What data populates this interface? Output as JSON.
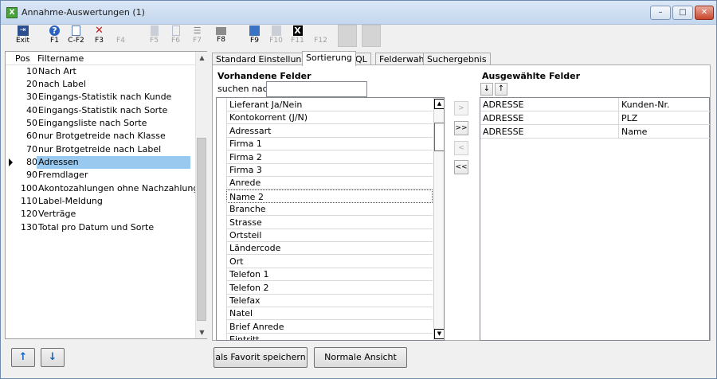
{
  "window": {
    "title": "Annahme-Auswertungen (1)",
    "app_icon": "X",
    "controls": {
      "minimize": "–",
      "maximize": "□",
      "close": "✕"
    }
  },
  "toolbar": {
    "items": [
      {
        "label": "Exit",
        "icon": "door-exit-icon",
        "glyph": "🚪",
        "enabled": true
      },
      {
        "label": "F1",
        "icon": "help-icon",
        "glyph": "?",
        "enabled": true
      },
      {
        "label": "C-F2",
        "icon": "new-document-icon",
        "glyph": "📄",
        "enabled": true
      },
      {
        "label": "F3",
        "icon": "delete-icon",
        "glyph": "✕",
        "enabled": true
      },
      {
        "label": "F4",
        "icon": "blank-icon",
        "glyph": "",
        "enabled": false
      },
      {
        "label": "F5",
        "icon": "hand-icon",
        "glyph": "✋",
        "enabled": false
      },
      {
        "label": "F6",
        "icon": "copy-icon",
        "glyph": "⧉",
        "enabled": false
      },
      {
        "label": "F7",
        "icon": "list-icon",
        "glyph": "☰",
        "enabled": false
      },
      {
        "label": "F8",
        "icon": "print-icon",
        "glyph": "🖨",
        "enabled": true
      },
      {
        "label": "F9",
        "icon": "screen-icon",
        "glyph": "▣",
        "enabled": true
      },
      {
        "label": "F10",
        "icon": "export-icon",
        "glyph": "⎙",
        "enabled": false
      },
      {
        "label": "F11",
        "icon": "excel-icon",
        "glyph": "X",
        "enabled": false
      },
      {
        "label": "F12",
        "icon": "blank-icon",
        "glyph": "",
        "enabled": false
      }
    ]
  },
  "filter_list": {
    "columns": {
      "pos": "Pos",
      "name": "Filtername"
    },
    "rows": [
      {
        "pos": "10",
        "name": "Nach Art"
      },
      {
        "pos": "20",
        "name": "nach Label"
      },
      {
        "pos": "30",
        "name": "Eingangs-Statistik nach Kunde"
      },
      {
        "pos": "40",
        "name": "Eingangs-Statistik nach Sorte"
      },
      {
        "pos": "50",
        "name": "Eingangsliste nach Sorte"
      },
      {
        "pos": "60",
        "name": "nur Brotgetreide nach Klasse"
      },
      {
        "pos": "70",
        "name": "nur Brotgetreide nach Label"
      },
      {
        "pos": "80",
        "name": "Adressen"
      },
      {
        "pos": "90",
        "name": "Fremdlager"
      },
      {
        "pos": "100",
        "name": "Akontozahlungen ohne Nachzahlung"
      },
      {
        "pos": "110",
        "name": "Label-Meldung"
      },
      {
        "pos": "120",
        "name": "Verträge"
      },
      {
        "pos": "130",
        "name": "Total pro Datum und Sorte"
      }
    ],
    "selected_pos": "80"
  },
  "tabs": [
    {
      "label": "Standard Einstellungen",
      "active": false
    },
    {
      "label": "Sortierung",
      "active": true
    },
    {
      "label": "SQL",
      "active": false
    },
    {
      "label": "Felderwahl",
      "active": false
    },
    {
      "label": "Suchergebnis",
      "active": false
    }
  ],
  "available": {
    "heading": "Vorhandene Felder",
    "search_label": "suchen nach:",
    "search_value": "",
    "fields": [
      "Lieferant Ja/Nein",
      "Kontokorrent (J/N)",
      "Adressart",
      "Firma 1",
      "Firma 2",
      "Firma 3",
      "Anrede",
      "Name 2",
      "Branche",
      "Strasse",
      "Ortsteil",
      "Ländercode",
      "Ort",
      "Telefon 1",
      "Telefon 2",
      "Telefax",
      "Natel",
      "Brief Anrede",
      "Eintritt"
    ],
    "focused_field": "Name 2"
  },
  "move_buttons": {
    "add": ">",
    "add_all": ">>",
    "remove": "<",
    "remove_all": "<<"
  },
  "selected": {
    "heading": "Ausgewählte Felder",
    "down": "↓",
    "up": "↑",
    "rows": [
      {
        "table": "ADRESSE",
        "field": "Kunden-Nr."
      },
      {
        "table": "ADRESSE",
        "field": "PLZ"
      },
      {
        "table": "ADRESSE",
        "field": "Name"
      }
    ]
  },
  "footer": {
    "up_arrow": "↑",
    "down_arrow": "↓",
    "save_favorite": "als Favorit speichern",
    "normal_view": "Normale Ansicht"
  }
}
